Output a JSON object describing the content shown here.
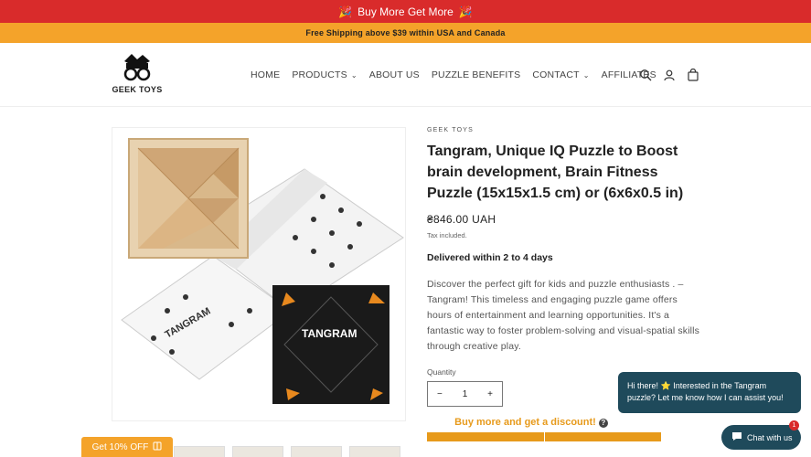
{
  "announcement": {
    "text": "Buy More Get More",
    "icon_left": "party-popper-icon",
    "icon_right": "party-popper-icon"
  },
  "shipping_bar": {
    "text": "Free Shipping above $39 within USA and Canada"
  },
  "logo": {
    "text": "GEEK TOYS"
  },
  "nav": {
    "home": "HOME",
    "products": "PRODUCTS",
    "about": "ABOUT US",
    "benefits": "PUZZLE BENEFITS",
    "contact": "CONTACT",
    "affiliates": "AFFILIATES"
  },
  "header_icons": [
    "search-icon",
    "account-icon",
    "cart-icon"
  ],
  "product": {
    "vendor": "GEEK TOYS",
    "title": "Tangram, Unique IQ Puzzle to Boost brain development, Brain Fitness Puzzle (15x15x1.5 cm) or (6x6x0.5 in)",
    "price": "₴846.00 UAH",
    "tax": "Tax included.",
    "delivery": "Delivered within 2 to 4 days",
    "description": "Discover the perfect gift for kids and puzzle enthusiasts . – Tangram! This timeless and engaging puzzle game offers hours of entertainment and learning opportunities. It's a fantastic way to foster problem-solving and visual-spatial skills through creative play.",
    "quantity_label": "Quantity",
    "quantity": "1",
    "minus": "−",
    "plus": "+",
    "discount_text": "Buy more and get a discount!",
    "box_label": "TANGRAM"
  },
  "chat": {
    "message": "Hi there! ⭐ Interested in the Tangram puzzle? Let me know how I can assist you!",
    "badge": "1",
    "button": "Chat with us"
  },
  "promo": {
    "label": "Get 10% OFF"
  },
  "colors": {
    "red_bar": "#d92b2b",
    "orange_bar": "#f4a32a",
    "chat": "#1f4a5b",
    "accent": "#e79a1b"
  }
}
